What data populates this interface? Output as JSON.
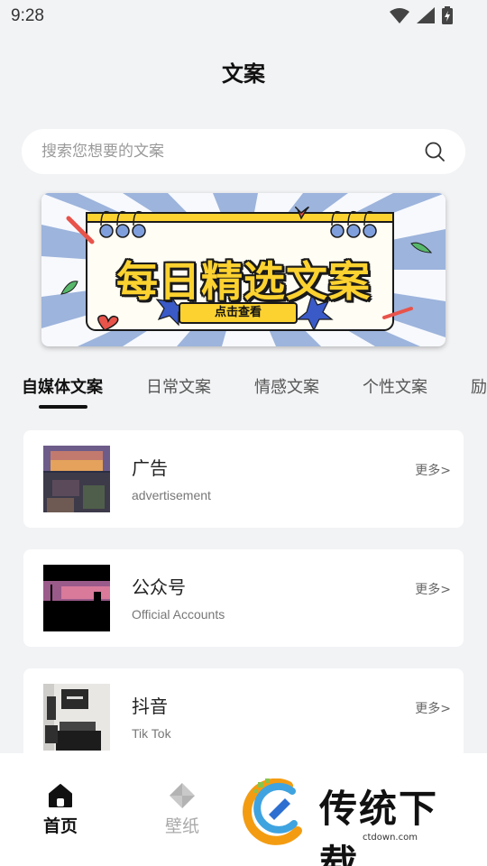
{
  "status_bar": {
    "time": "9:28"
  },
  "header": {
    "title": "文案"
  },
  "search": {
    "placeholder": "搜索您想要的文案"
  },
  "banner": {
    "title": "每日精选文案",
    "button_label": "点击查看"
  },
  "tabs": [
    {
      "label": "自媒体文案",
      "active": true
    },
    {
      "label": "日常文案",
      "active": false
    },
    {
      "label": "情感文案",
      "active": false
    },
    {
      "label": "个性文案",
      "active": false
    },
    {
      "label": "励",
      "active": false
    }
  ],
  "cards": [
    {
      "title": "广告",
      "subtitle": "advertisement",
      "more": "更多>"
    },
    {
      "title": "公众号",
      "subtitle": "Official Accounts",
      "more": "更多>"
    },
    {
      "title": "抖音",
      "subtitle": "Tik Tok",
      "more": "更多>"
    }
  ],
  "bottom_nav": [
    {
      "label": "首页",
      "icon": "home-icon",
      "active": true
    },
    {
      "label": "壁纸",
      "icon": "wallpaper-icon",
      "active": false
    }
  ],
  "watermark": {
    "text": "传统下载",
    "url": "ctdown.com"
  }
}
